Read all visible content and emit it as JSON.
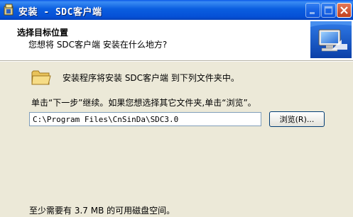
{
  "window": {
    "title": "安装 - SDC客户端"
  },
  "header": {
    "title": "选择目标位置",
    "subtitle": "您想将 SDC客户端 安装在什么地方?"
  },
  "content": {
    "info_text": "安装程序将安装 SDC客户端 到下列文件夹中。",
    "instruction_text": "单击“下一步”继续。如果您想选择其它文件夹,单击“浏览”。",
    "path_value": "C:\\Program Files\\CnSinDa\\SDC3.0",
    "browse_label": "浏览(R)...",
    "space_required": "至少需要有 3.7 MB 的可用磁盘空间。"
  },
  "icons": {
    "app": "installer-app-icon",
    "folder": "folder-icon",
    "wizard": "computer-monitor-icon"
  }
}
